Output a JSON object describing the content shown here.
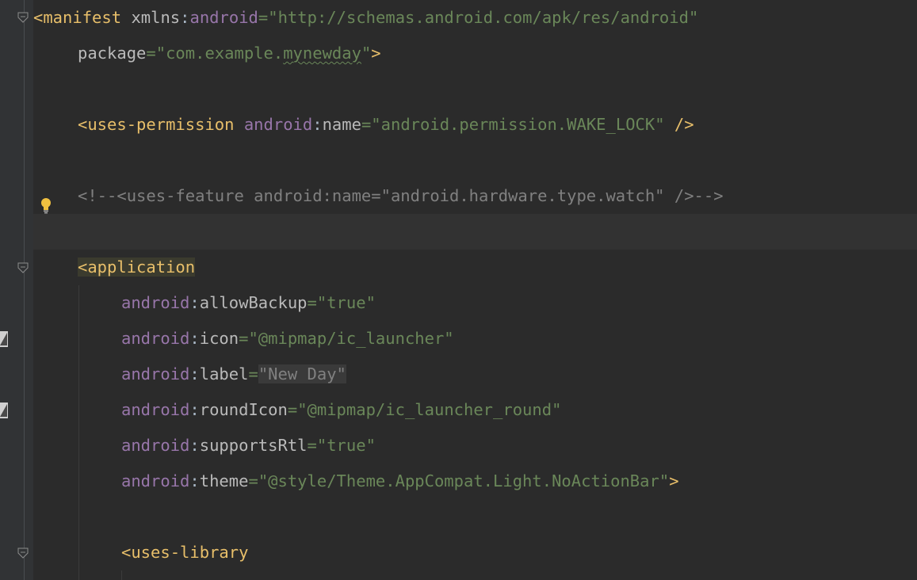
{
  "editor": {
    "lines": [
      {
        "tag_open": "<manifest",
        "ns_attr": "xmlns",
        "colon": ":",
        "ns_name": "android",
        "eq": "=",
        "value": "\"http://schemas.android.com/apk/res/android\""
      },
      {
        "attr": "package",
        "eq": "=",
        "value_pre": "\"com.example.",
        "value_squig": "mynewday",
        "value_post": "\"",
        "tag_close": ">"
      },
      {
        "tag_open": "<uses-permission",
        "ns": "android",
        "colon": ":",
        "attr": "name",
        "eq": "=",
        "value": "\"android.permission.WAKE_LOCK\"",
        "tag_close": " />"
      },
      {
        "comment": "<!--<uses-feature android:name=\"android.hardware.type.watch\" />-->"
      },
      {
        "lt": "<",
        "tag_name": "application"
      },
      {
        "ns": "android",
        "colon": ":",
        "attr": "allowBackup",
        "eq": "=",
        "value": "\"true\""
      },
      {
        "ns": "android",
        "colon": ":",
        "attr": "icon",
        "eq": "=",
        "value": "\"@mipmap/ic_launcher\""
      },
      {
        "ns": "android",
        "colon": ":",
        "attr": "label",
        "eq": "=",
        "value": "\"New Day\""
      },
      {
        "ns": "android",
        "colon": ":",
        "attr": "roundIcon",
        "eq": "=",
        "value": "\"@mipmap/ic_launcher_round\""
      },
      {
        "ns": "android",
        "colon": ":",
        "attr": "supportsRtl",
        "eq": "=",
        "value": "\"true\""
      },
      {
        "ns": "android",
        "colon": ":",
        "attr": "theme",
        "eq": "=",
        "value": "\"@style/Theme.AppCompat.Light.NoActionBar\"",
        "tag_close": ">"
      },
      {
        "tag_open": "<uses-library"
      }
    ]
  },
  "icons": {
    "bulb": "lightbulb-icon",
    "fold": "fold-marker-icon",
    "bookmark": "gutter-marker-icon"
  },
  "colors": {
    "background": "#2b2b2b",
    "gutter": "#313335",
    "tag": "#e8bf6a",
    "namespace": "#9876aa",
    "attribute": "#bababa",
    "string": "#6a8759",
    "comment": "#808080",
    "bulb": "#f0c040"
  }
}
